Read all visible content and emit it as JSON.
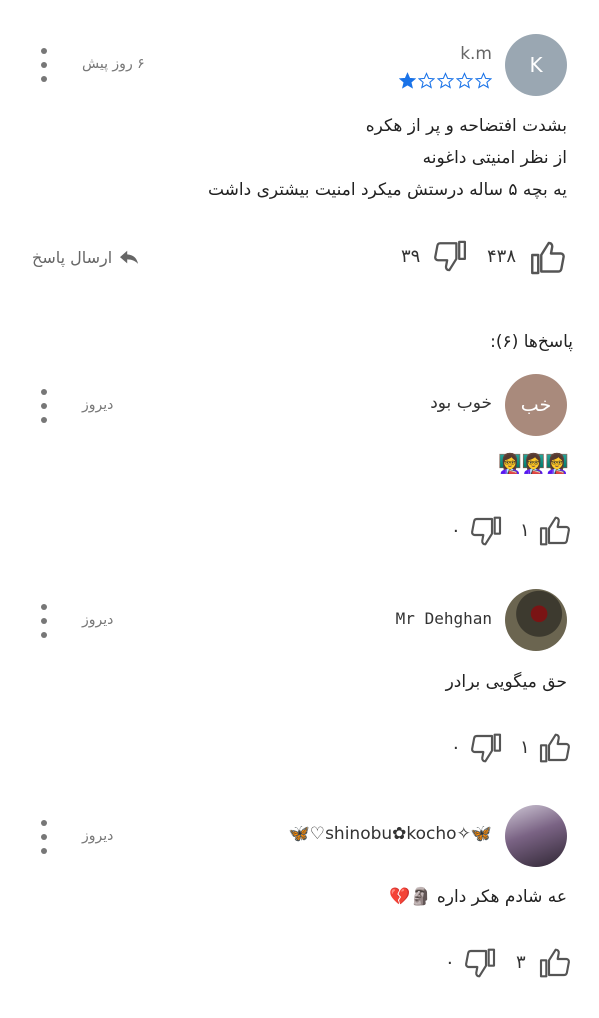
{
  "main_comment": {
    "author": "k.m",
    "avatar_letter": "K",
    "avatar_color": "#9aa7b2",
    "time": "۶ روز پیش",
    "rating": 1,
    "rating_max": 5,
    "star_color": "#1a73e8",
    "lines": [
      "بشدت افتضاحه و پر از هکره",
      "از نظر امنیتی داغونه",
      "یه بچه ۵ ساله درستش میکرد امنیت بیشتری داشت"
    ],
    "likes": "۴۳۸",
    "dislikes": "۳۹",
    "reply_label": "ارسال پاسخ"
  },
  "replies_title": "پاسخ‌ها (۶):",
  "replies": [
    {
      "author": "خوب بود",
      "avatar_letter": "خب",
      "avatar_color": "#a98a7c",
      "time": "دیروز",
      "text": "👩‍🏫👩‍🏫👩‍🏫",
      "likes": "۱",
      "dislikes": "۰"
    },
    {
      "author": "Mr Dehghan",
      "avatar_color": "#5a5a4a",
      "time": "دیروز",
      "text": "حق میگویی برادر",
      "likes": "۱",
      "dislikes": "۰"
    },
    {
      "author": "🦋✧shinobu✿kocho♡🦋",
      "avatar_color": "#6e5a7a",
      "time": "دیروز",
      "text": "عه شادم هکر داره 🗿💔",
      "likes": "۳",
      "dislikes": "۰"
    }
  ]
}
